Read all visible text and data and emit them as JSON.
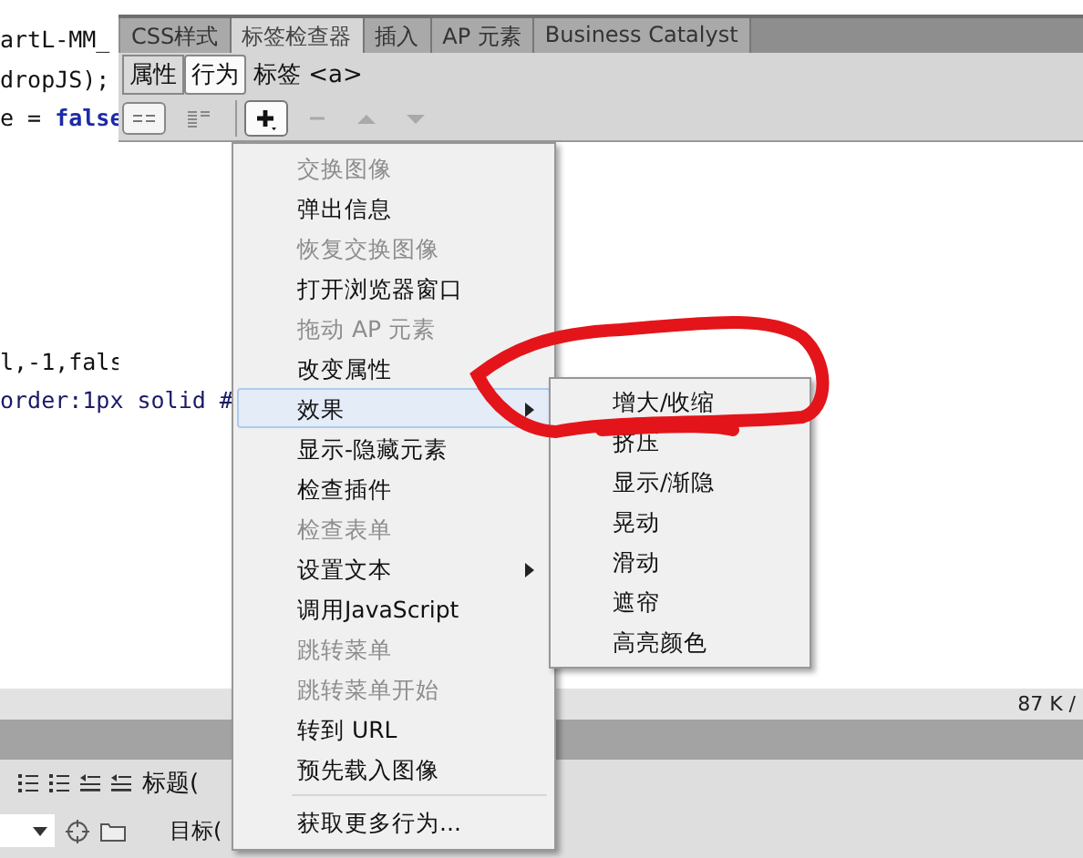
{
  "editor": {
    "code_above": [
      [
        {
          "text": "artL-MM_",
          "kind": "plain"
        }
      ],
      [
        {
          "text": "dropJS);",
          "kind": "plain"
        }
      ],
      [
        {
          "text": "e = ",
          "kind": "plain"
        },
        {
          "text": "false",
          "kind": "keyword"
        }
      ]
    ],
    "code_below": [
      [
        {
          "text": "l,-1,fals",
          "kind": "plain"
        }
      ],
      [
        {
          "text": "order:1px solid #",
          "kind": "css"
        }
      ]
    ]
  },
  "panel": {
    "tabs": [
      {
        "label": "CSS样式",
        "selected": false
      },
      {
        "label": "标签检查器",
        "selected": true
      },
      {
        "label": "插入",
        "selected": false
      },
      {
        "label": "AP 元素",
        "selected": false
      },
      {
        "label": "Business Catalyst",
        "selected": false
      }
    ],
    "modes": [
      {
        "label": "属性",
        "selected": false
      },
      {
        "label": "行为",
        "selected": true
      }
    ],
    "tag_label": "标签 <a>",
    "views": [
      {
        "kind": "events-shown",
        "selected": true
      },
      {
        "kind": "all-events",
        "selected": false
      }
    ],
    "actions": [
      {
        "kind": "add",
        "disabled": false
      },
      {
        "kind": "remove",
        "disabled": true
      },
      {
        "kind": "up",
        "disabled": true
      },
      {
        "kind": "down",
        "disabled": true
      }
    ]
  },
  "menu": {
    "items": [
      {
        "kind": "item",
        "label": "交换图像",
        "disabled": true,
        "submenu": false,
        "selected": false
      },
      {
        "kind": "item",
        "label": "弹出信息",
        "disabled": false,
        "submenu": false,
        "selected": false
      },
      {
        "kind": "item",
        "label": "恢复交换图像",
        "disabled": true,
        "submenu": false,
        "selected": false
      },
      {
        "kind": "item",
        "label": "打开浏览器窗口",
        "disabled": false,
        "submenu": false,
        "selected": false
      },
      {
        "kind": "item",
        "label": "拖动 AP 元素",
        "disabled": true,
        "submenu": false,
        "selected": false
      },
      {
        "kind": "item",
        "label": "改变属性",
        "disabled": false,
        "submenu": false,
        "selected": false
      },
      {
        "kind": "item",
        "label": "效果",
        "disabled": false,
        "submenu": true,
        "selected": true
      },
      {
        "kind": "item",
        "label": "显示-隐藏元素",
        "disabled": false,
        "submenu": false,
        "selected": false
      },
      {
        "kind": "item",
        "label": "检查插件",
        "disabled": false,
        "submenu": false,
        "selected": false
      },
      {
        "kind": "item",
        "label": "检查表单",
        "disabled": true,
        "submenu": false,
        "selected": false
      },
      {
        "kind": "item",
        "label": "设置文本",
        "disabled": false,
        "submenu": true,
        "selected": false
      },
      {
        "kind": "item",
        "label": "调用JavaScript",
        "disabled": false,
        "submenu": false,
        "selected": false
      },
      {
        "kind": "item",
        "label": "跳转菜单",
        "disabled": true,
        "submenu": false,
        "selected": false
      },
      {
        "kind": "item",
        "label": "跳转菜单开始",
        "disabled": true,
        "submenu": false,
        "selected": false
      },
      {
        "kind": "item",
        "label": "转到 URL",
        "disabled": false,
        "submenu": false,
        "selected": false
      },
      {
        "kind": "item",
        "label": "预先载入图像",
        "disabled": false,
        "submenu": false,
        "selected": false
      },
      {
        "kind": "separator"
      },
      {
        "kind": "item",
        "label": "获取更多行为...",
        "disabled": false,
        "submenu": false,
        "selected": false
      }
    ]
  },
  "submenu": {
    "items": [
      {
        "label": "增大/收缩"
      },
      {
        "label": "挤压"
      },
      {
        "label": "显示/渐隐"
      },
      {
        "label": "晃动"
      },
      {
        "label": "滑动"
      },
      {
        "label": "遮帘"
      },
      {
        "label": "高亮颜色"
      }
    ]
  },
  "status_bar": {
    "size": "87 K /"
  },
  "properties": {
    "heading_label": "标题(",
    "target_label": "目标("
  }
}
